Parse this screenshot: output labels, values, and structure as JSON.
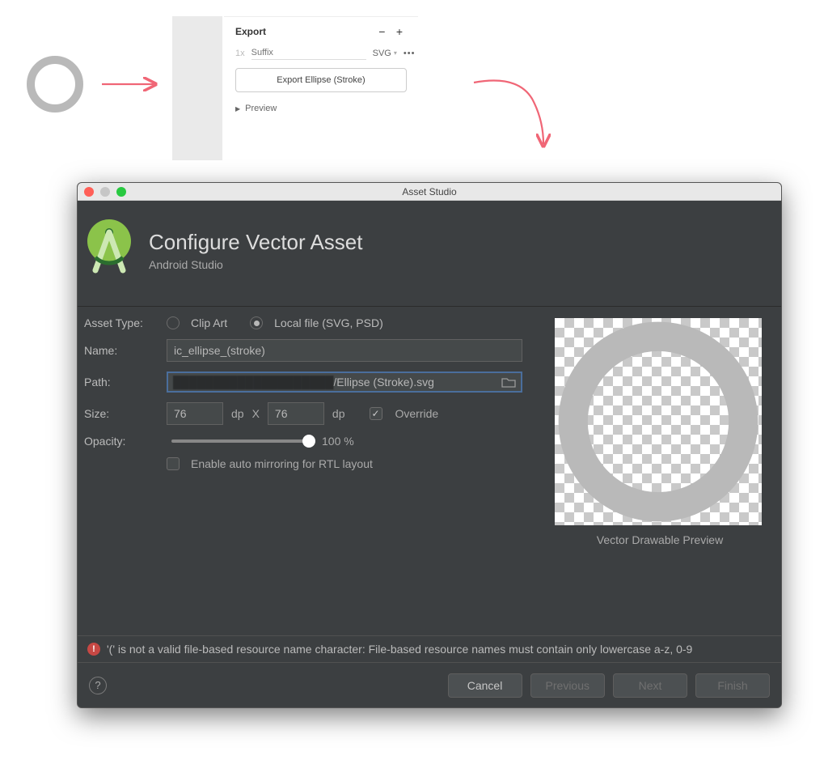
{
  "figma": {
    "title": "Export",
    "scale": "1x",
    "suffix_placeholder": "Suffix",
    "format": "SVG",
    "export_button": "Export Ellipse (Stroke)",
    "preview_label": "Preview"
  },
  "dialog": {
    "window_title": "Asset Studio",
    "title": "Configure Vector Asset",
    "subtitle": "Android Studio",
    "form": {
      "asset_type_label": "Asset Type:",
      "radio_clipart": "Clip Art",
      "radio_localfile": "Local file (SVG, PSD)",
      "name_label": "Name:",
      "name_value": "ic_ellipse_(stroke)",
      "path_label": "Path:",
      "path_prefix_obscured": "████████████████████",
      "path_value": "/Ellipse (Stroke).svg",
      "size_label": "Size:",
      "size_w": "76",
      "size_h": "76",
      "size_unit": "dp",
      "size_sep": "X",
      "override_label": "Override",
      "opacity_label": "Opacity:",
      "opacity_value": "100 %",
      "rtl_label": "Enable auto mirroring for RTL layout"
    },
    "preview_caption": "Vector Drawable Preview",
    "error_text": "'(' is not a valid file-based resource name character: File-based resource names must contain only lowercase a-z, 0-9",
    "buttons": {
      "cancel": "Cancel",
      "previous": "Previous",
      "next": "Next",
      "finish": "Finish"
    }
  },
  "colors": {
    "ring": "#b9b9b9",
    "arrow": "#f06676"
  }
}
